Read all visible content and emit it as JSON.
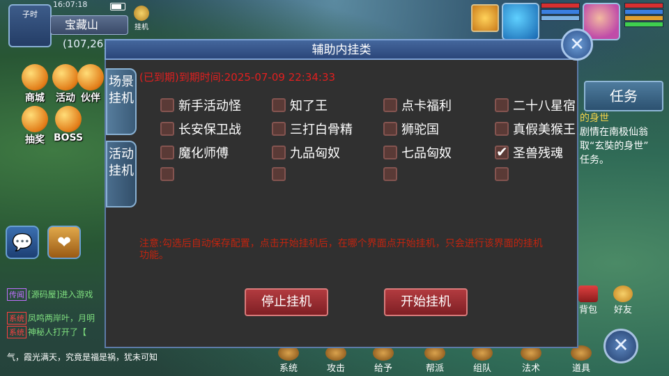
{
  "hud": {
    "time_label": "子时",
    "clock": "16:07:18",
    "map_name": "宝藏山",
    "coords": "(107,26)",
    "hangup_label": "挂机"
  },
  "left_icons": [
    {
      "label": "商城"
    },
    {
      "label": "活动"
    },
    {
      "label": "伙伴"
    },
    {
      "label": "抽奖"
    },
    {
      "label": "BOSS"
    }
  ],
  "chat": [
    {
      "tag": "传闻",
      "text": "[源码屋]进入游戏",
      "tag_color": "#c070ff"
    },
    {
      "tag": "系统",
      "text": "凤鸣两岸叶，月明",
      "tag_color": "#ff4040"
    },
    {
      "tag": "系统",
      "text": "神秘人打开了【",
      "tag_color": "#ff4040"
    },
    {
      "tag": "",
      "text": "气，霞光满天，究竟是福是祸，犹未可知",
      "tag_color": ""
    }
  ],
  "task": {
    "button": "任务",
    "lines": [
      "的身世",
      "剧情在南极仙翁",
      "取“玄奘的身世”",
      "任务。"
    ]
  },
  "bottom_bar": [
    "系统",
    "攻击",
    "给予",
    "帮派",
    "组队",
    "法术",
    "道具"
  ],
  "bottom_right": [
    "背包",
    "好友"
  ],
  "dialog": {
    "title": "辅助内挂类",
    "close": "✕",
    "tabs": [
      "场景挂机",
      "活动挂机"
    ],
    "expire_text": "(已到期)到期时间:2025-07-09 22:34:33",
    "options": [
      [
        {
          "label": "新手活动怪",
          "checked": false
        },
        {
          "label": "知了王",
          "checked": false
        },
        {
          "label": "点卡福利",
          "checked": false
        },
        {
          "label": "二十八星宿",
          "checked": false
        }
      ],
      [
        {
          "label": "长安保卫战",
          "checked": false
        },
        {
          "label": "三打白骨精",
          "checked": false
        },
        {
          "label": "狮驼国",
          "checked": false
        },
        {
          "label": "真假美猴王",
          "checked": false
        }
      ],
      [
        {
          "label": "魔化师傅",
          "checked": false
        },
        {
          "label": "九品匈奴",
          "checked": false
        },
        {
          "label": "七品匈奴",
          "checked": false
        },
        {
          "label": "圣兽残魂",
          "checked": true
        }
      ],
      [
        {
          "label": "",
          "checked": false
        },
        {
          "label": "",
          "checked": false
        },
        {
          "label": "",
          "checked": false
        },
        {
          "label": "",
          "checked": false
        }
      ]
    ],
    "note": "注意:勾选后自动保存配置，点击开始挂机后，在哪个界面点开始挂机，只会进行该界面的挂机功能。",
    "stop_button": "停止挂机",
    "start_button": "开始挂机"
  },
  "colors": {
    "dialog_bg": "#303030",
    "header": "#34568a",
    "expire_red": "#e21f1f",
    "note_red": "#c2240f",
    "button_red": "#9c2b30"
  }
}
